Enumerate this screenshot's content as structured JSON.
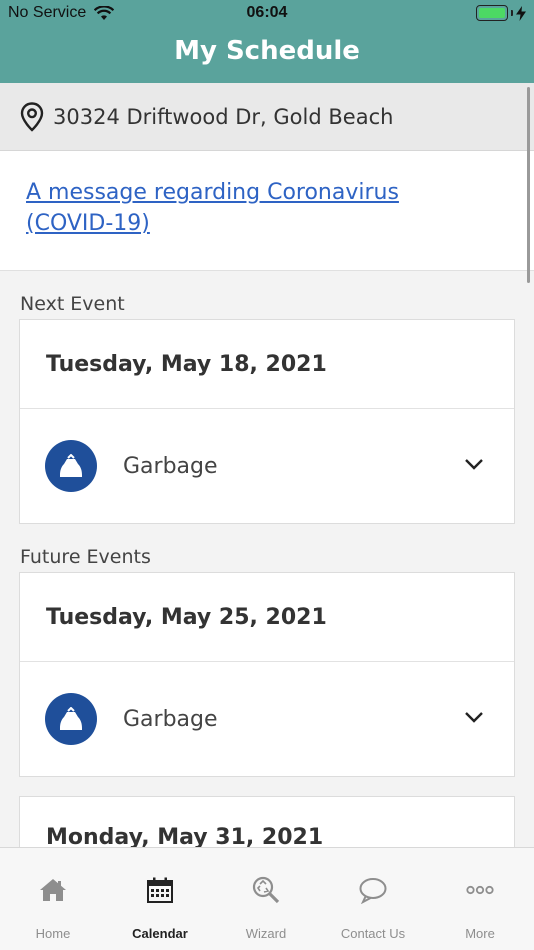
{
  "status_bar": {
    "carrier": "No Service",
    "time": "06:04"
  },
  "header": {
    "title": "My Schedule",
    "color": "#5aa39c"
  },
  "address": {
    "text": "30324 Driftwood Dr, Gold Beach",
    "icon": "location-pin-icon"
  },
  "message": {
    "link_text": "A message regarding Coronavirus (COVID-19)"
  },
  "next_event": {
    "section_label": "Next Event",
    "date": "Tuesday, May 18, 2021",
    "type": "Garbage",
    "icon": "garbage-bag-icon"
  },
  "future_events": {
    "section_label": "Future Events",
    "events": [
      {
        "date": "Tuesday, May 25, 2021",
        "type": "Garbage",
        "icon": "garbage-bag-icon"
      },
      {
        "date": "Monday, May 31, 2021"
      }
    ]
  },
  "tabs": [
    {
      "label": "Home",
      "icon": "home-icon"
    },
    {
      "label": "Calendar",
      "icon": "calendar-icon",
      "active": true
    },
    {
      "label": "Wizard",
      "icon": "recycle-search-icon"
    },
    {
      "label": "Contact Us",
      "icon": "chat-bubble-icon"
    },
    {
      "label": "More",
      "icon": "more-dots-icon"
    }
  ],
  "colors": {
    "accent": "#5aa39c",
    "event_icon_bg": "#1f4f9a",
    "link": "#2e63c4"
  }
}
